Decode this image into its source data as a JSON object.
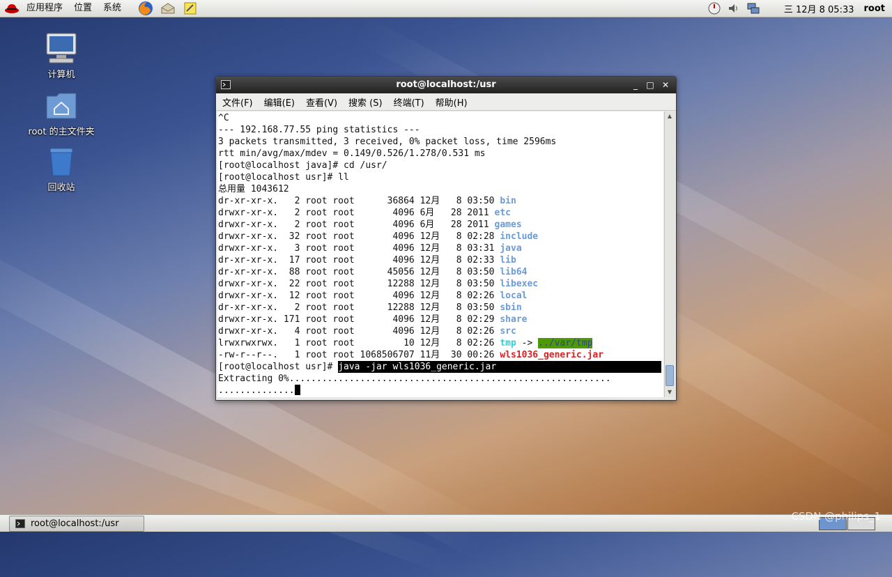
{
  "top_panel": {
    "menus": [
      "应用程序",
      "位置",
      "系统"
    ],
    "clock": "三 12月  8 05:33",
    "user": "root"
  },
  "desktop_icons": [
    "计算机",
    "root 的主文件夹",
    "回收站"
  ],
  "window": {
    "title": "root@localhost:/usr",
    "menus": [
      "文件(F)",
      "编辑(E)",
      "查看(V)",
      "搜索 (S)",
      "终端(T)",
      "帮助(H)"
    ],
    "minimize": "_",
    "maximize": "□",
    "close": "✕"
  },
  "terminal": {
    "pre_lines": [
      "^C",
      "--- 192.168.77.55 ping statistics ---",
      "3 packets transmitted, 3 received, 0% packet loss, time 2596ms",
      "rtt min/avg/max/mdev = 0.149/0.526/1.278/0.531 ms",
      "[root@localhost java]# cd /usr/",
      "[root@localhost usr]# ll",
      "总用量 1043612"
    ],
    "listing": [
      {
        "prefix": "dr-xr-xr-x.   2 root root      36864 12月   8 03:50 ",
        "name": "bin",
        "type": "dir"
      },
      {
        "prefix": "drwxr-xr-x.   2 root root       4096 6月   28 2011 ",
        "name": "etc",
        "type": "dir"
      },
      {
        "prefix": "drwxr-xr-x.   2 root root       4096 6月   28 2011 ",
        "name": "games",
        "type": "dir"
      },
      {
        "prefix": "drwxr-xr-x.  32 root root       4096 12月   8 02:28 ",
        "name": "include",
        "type": "dir"
      },
      {
        "prefix": "drwxr-xr-x.   3 root root       4096 12月   8 03:31 ",
        "name": "java",
        "type": "dir"
      },
      {
        "prefix": "dr-xr-xr-x.  17 root root       4096 12月   8 02:33 ",
        "name": "lib",
        "type": "dir"
      },
      {
        "prefix": "dr-xr-xr-x.  88 root root      45056 12月   8 03:50 ",
        "name": "lib64",
        "type": "dir"
      },
      {
        "prefix": "drwxr-xr-x.  22 root root      12288 12月   8 03:50 ",
        "name": "libexec",
        "type": "dir"
      },
      {
        "prefix": "drwxr-xr-x.  12 root root       4096 12月   8 02:26 ",
        "name": "local",
        "type": "dir"
      },
      {
        "prefix": "dr-xr-xr-x.   2 root root      12288 12月   8 03:50 ",
        "name": "sbin",
        "type": "dir"
      },
      {
        "prefix": "drwxr-xr-x. 171 root root       4096 12月   8 02:29 ",
        "name": "share",
        "type": "dir"
      },
      {
        "prefix": "drwxr-xr-x.   4 root root       4096 12月   8 02:26 ",
        "name": "src",
        "type": "dir"
      },
      {
        "prefix": "lrwxrwxrwx.   1 root root         10 12月   8 02:26 ",
        "name": "tmp",
        "type": "link",
        "arrow": " -> ",
        "target": "../var/tmp"
      },
      {
        "prefix": "-rw-r--r--.   1 root root 1068506707 11月  30 00:26 ",
        "name": "wls1036_generic.jar",
        "type": "jar"
      }
    ],
    "prompt": "[root@localhost usr]# ",
    "command": "java -jar wls1036_generic.jar",
    "extract_line": "Extracting 0%...........................................................",
    "dots_line": ".............."
  },
  "taskbar": {
    "task_label": "root@localhost:/usr"
  },
  "watermark": "CSDN @philips_1",
  "colors": {
    "dir": "#6b9bd6",
    "link": "#2fd4d4",
    "link_target_bg": "#4e9a06",
    "jar": "#e02020"
  }
}
